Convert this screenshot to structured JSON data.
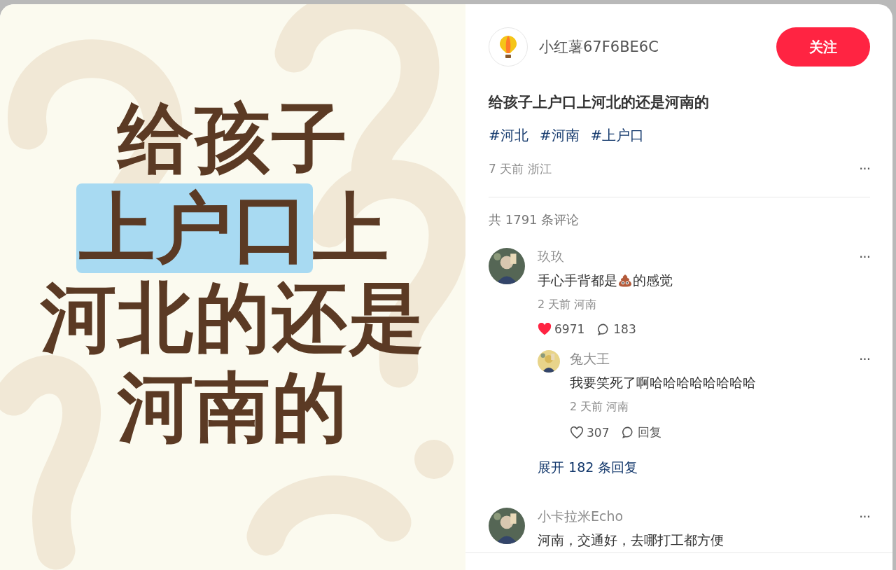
{
  "cover": {
    "lines": [
      {
        "segments": [
          {
            "text": "给孩子",
            "highlighted": false
          }
        ]
      },
      {
        "segments": [
          {
            "text": "上户口",
            "highlighted": true
          },
          {
            "text": "上",
            "highlighted": false
          }
        ]
      },
      {
        "segments": [
          {
            "text": "河北的还是",
            "highlighted": false
          }
        ]
      },
      {
        "segments": [
          {
            "text": "河南的",
            "highlighted": false
          }
        ]
      }
    ]
  },
  "author": {
    "name": "小红薯67F6BE6C",
    "follow_label": "关注"
  },
  "post": {
    "title": "给孩子上户口上河北的还是河南的",
    "tags": [
      "#河北",
      "#河南",
      "#上户口"
    ],
    "meta": "7 天前 浙江",
    "more": "···"
  },
  "comment_count": "共 1791 条评论",
  "comments": [
    {
      "name": "玖玖",
      "content": [
        {
          "kind": "text",
          "text": "手心手背都是"
        },
        {
          "kind": "emoji"
        },
        {
          "kind": "text",
          "text": "的感觉"
        }
      ],
      "meta": "2 天前 河南",
      "likes": "6971",
      "liked": true,
      "replies_label": "183",
      "more": "···",
      "replies": [
        {
          "name": "兔大王",
          "content": [
            {
              "kind": "text",
              "text": "我要笑死了啊哈哈哈哈哈哈哈哈"
            }
          ],
          "meta": "2 天前 河南",
          "likes": "307",
          "liked": false,
          "replies_label": "回复",
          "more": "···"
        }
      ],
      "expand": "展开 182 条回复"
    },
    {
      "name": "小卡拉米Echo",
      "content": [
        {
          "kind": "text",
          "text": "河南，交通好，去哪打工都方便"
        }
      ],
      "more": "···"
    }
  ]
}
